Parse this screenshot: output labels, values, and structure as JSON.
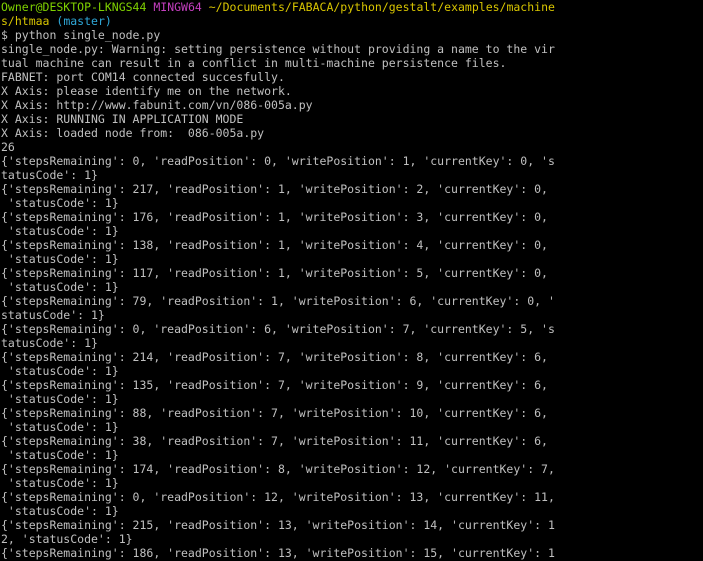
{
  "colors": {
    "background": "#000000",
    "text": "#c0c0c0",
    "user_host": "#7fd100",
    "mingw": "#c43fbf",
    "path": "#d8c500",
    "branch": "#2fa8d8"
  },
  "prompt": {
    "user_host": "Owner@DESKTOP-LKNGS44",
    "env": "MINGW64",
    "path_line1": "~/Documents/FABACA/python/gestalt/examples/machine",
    "path_line2": "s/htmaa",
    "branch": "(master)",
    "command": "$ python single_node.py"
  },
  "output_lines": [
    "single_node.py: Warning: setting persistence without providing a name to the vir",
    "tual machine can result in a conflict in multi-machine persistence files.",
    "FABNET: port COM14 connected succesfully.",
    "X Axis: please identify me on the network.",
    "X Axis: http://www.fabunit.com/vn/086-005a.py",
    "X Axis: RUNNING IN APPLICATION MODE",
    "X Axis: loaded node from:  086-005a.py",
    "26",
    "{'stepsRemaining': 0, 'readPosition': 0, 'writePosition': 1, 'currentKey': 0, 's",
    "tatusCode': 1}",
    "{'stepsRemaining': 217, 'readPosition': 1, 'writePosition': 2, 'currentKey': 0,",
    " 'statusCode': 1}",
    "{'stepsRemaining': 176, 'readPosition': 1, 'writePosition': 3, 'currentKey': 0,",
    " 'statusCode': 1}",
    "{'stepsRemaining': 138, 'readPosition': 1, 'writePosition': 4, 'currentKey': 0,",
    " 'statusCode': 1}",
    "{'stepsRemaining': 117, 'readPosition': 1, 'writePosition': 5, 'currentKey': 0,",
    " 'statusCode': 1}",
    "{'stepsRemaining': 79, 'readPosition': 1, 'writePosition': 6, 'currentKey': 0, '",
    "statusCode': 1}",
    "{'stepsRemaining': 0, 'readPosition': 6, 'writePosition': 7, 'currentKey': 5, 's",
    "tatusCode': 1}",
    "{'stepsRemaining': 214, 'readPosition': 7, 'writePosition': 8, 'currentKey': 6,",
    " 'statusCode': 1}",
    "{'stepsRemaining': 135, 'readPosition': 7, 'writePosition': 9, 'currentKey': 6,",
    " 'statusCode': 1}",
    "{'stepsRemaining': 88, 'readPosition': 7, 'writePosition': 10, 'currentKey': 6,",
    " 'statusCode': 1}",
    "{'stepsRemaining': 38, 'readPosition': 7, 'writePosition': 11, 'currentKey': 6,",
    " 'statusCode': 1}",
    "{'stepsRemaining': 174, 'readPosition': 8, 'writePosition': 12, 'currentKey': 7,",
    " 'statusCode': 1}",
    "{'stepsRemaining': 0, 'readPosition': 12, 'writePosition': 13, 'currentKey': 11,",
    " 'statusCode': 1}",
    "{'stepsRemaining': 215, 'readPosition': 13, 'writePosition': 14, 'currentKey': 1",
    "2, 'statusCode': 1}",
    "{'stepsRemaining': 186, 'readPosition': 13, 'writePosition': 15, 'currentKey': 1"
  ]
}
